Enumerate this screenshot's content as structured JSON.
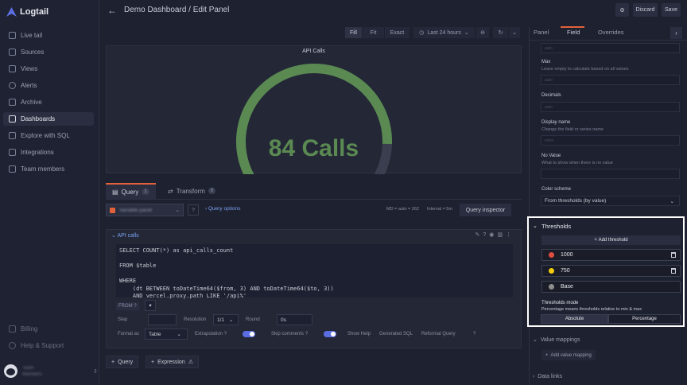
{
  "sidebar": {
    "logo": "Logtail",
    "items": [
      {
        "label": "Live tail"
      },
      {
        "label": "Sources"
      },
      {
        "label": "Views"
      },
      {
        "label": "Alerts"
      },
      {
        "label": "Archive"
      },
      {
        "label": "Dashboards"
      },
      {
        "label": "Explore with SQL"
      },
      {
        "label": "Integrations"
      },
      {
        "label": "Team members"
      }
    ],
    "bottom_items": [
      {
        "label": "Billing"
      },
      {
        "label": "Help & Support"
      }
    ],
    "user": {
      "name": "Team",
      "org": "Members"
    }
  },
  "header": {
    "title": "Demo Dashboard / Edit Panel",
    "discard_label": "Discard",
    "save_label": "Save"
  },
  "toolbar": {
    "fill": "Fill",
    "fit": "Fit",
    "exact": "Exact",
    "time_range": "Last 24 hours"
  },
  "panel": {
    "title": "API Calls",
    "value_text": "84 Calls",
    "gauge_fraction": 0.84,
    "gauge_color": "#5a8a52"
  },
  "query_tabs": [
    {
      "label": "Query",
      "count": "1"
    },
    {
      "label": "Transform",
      "count": "0"
    }
  ],
  "query_options": {
    "datasource": "Variable panel",
    "options_label": "Query options",
    "meta": "MD = auto = 262",
    "interval": "Interval = 5m",
    "inspector_label": "Query inspector"
  },
  "query": {
    "name": "API calls",
    "sql": "SELECT COUNT(*) as api_calls_count\n\nFROM $table\n\nWHERE\n    (dt BETWEEN toDateTime64($from, 3) AND toDateTime64($to, 3))\n    AND vercel.proxy.path LIKE '/api%'",
    "from_label": "FROM",
    "step_label": "Step",
    "resolution_label": "Resolution",
    "resolution_value": "1/1",
    "round_label": "Round",
    "round_value": "0s",
    "format_label": "Format as",
    "format_value": "Table",
    "extrapolation_label": "Extrapolation",
    "skip_comments_label": "Skip comments",
    "show_help": "Show Help",
    "generated_sql": "Generated SQL",
    "reformat_query": "Reformat Query"
  },
  "add_buttons": {
    "query": "Query",
    "expression": "Expression"
  },
  "right_panel": {
    "tabs": [
      "Panel",
      "Field",
      "Overrides"
    ],
    "active_tab": "Field",
    "fields": {
      "max_label": "Max",
      "max_desc": "Leave empty to calculate based on all values",
      "decimals_label": "Decimals",
      "display_name_label": "Display name",
      "display_name_desc": "Change the field or series name",
      "no_value_label": "No Value",
      "no_value_desc": "What to show when there is no value",
      "color_scheme_label": "Color scheme",
      "color_scheme_value": "From thresholds (by value)",
      "placeholder_auto": "auto",
      "placeholder_none": "none"
    },
    "thresholds": {
      "title": "Thresholds",
      "add_label": "Add threshold",
      "rows": [
        {
          "value": "1000",
          "color": "#e24d42"
        },
        {
          "value": "750",
          "color": "#f2cc0c"
        },
        {
          "value": "Base",
          "color": "#8e8e8e"
        }
      ],
      "mode_label": "Thresholds mode",
      "mode_desc": "Percentage means thresholds relative to min & max",
      "mode_absolute": "Absolute",
      "mode_percentage": "Percentage"
    },
    "value_mappings": {
      "title": "Value mappings",
      "add_label": "Add value mapping"
    },
    "data_links_title": "Data links"
  }
}
